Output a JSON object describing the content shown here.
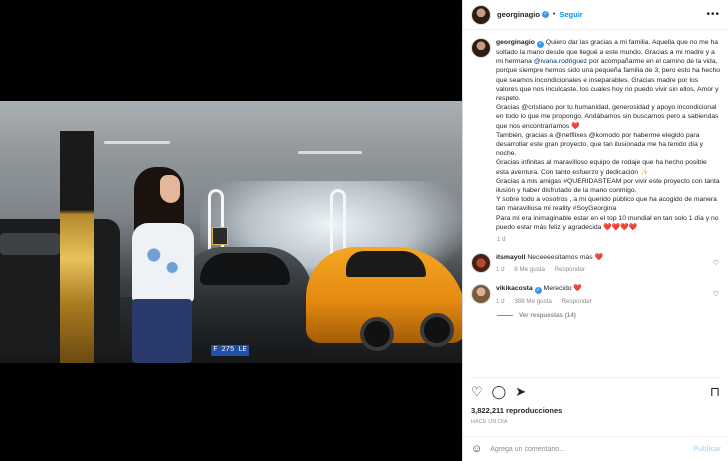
{
  "post": {
    "username": "georginagio",
    "follow_label": "Seguir",
    "more_label": "•••",
    "caption": [
      {
        "type": "user",
        "text": "georginagio"
      },
      {
        "type": "text",
        "text": " Quiero dar las gracias a mi familia. Aquella que no me ha soltado la mano desde que llegué a este mundo. Gracias a mi madre y a mi hermana "
      },
      {
        "type": "mention",
        "text": "@ivana.rodriguez"
      },
      {
        "type": "text",
        "text": " por acompañarme en el camino de la vida, porque siempre hemos sido una pequeña familia de 3, pero esto ha hecho que seamos incondicionales e inseparables. Gracias madre por los valores que nos inculcaste, los cuales hoy no puedo vivir sin ellos. Amor y respeto."
      }
    ],
    "caption_p2": "Gracias @cristiano por tu humanidad, generosidad y apoyo incondicional en todo lo que me propongo. Andábamos sin buscarnos pero a sabiendas que nos encontraríamos ❤️",
    "caption_p3": "También, gracias a @netflixes @komodo por haberme elegido para desarrollar este gran proyecto, que tan ilusionada me ha tenido día y noche.",
    "caption_p4": "Gracias infinitas al maravilloso equipo de rodaje que ha hecho posible esta aventura. Con tanto esfuerzo y dedicación ✨",
    "caption_p5": "Gracias a mis amigas #QUERIDASTEAM por vivir este proyecto con tanta ilusión y haber disfrutado de la mano conmigo.",
    "caption_p6": "Y sobre todo a vosotros , a mi querido público que ha acogido de manera tan maravillosa mi reality #SoyGeorgina",
    "caption_p7": "Para mí era inimaginable estar en el top 10 mundial en tan solo 1 día y no puedo estar más feliz y agradecida ❤️❤️❤️❤️",
    "caption_time": "1 d",
    "video_plate": "F 275 LE"
  },
  "comments": [
    {
      "username": "itsmayoll",
      "text": " Neceeeesitamos más ❤️",
      "time": "1 d",
      "likes": "8 Me gusta",
      "reply_label": "Responder"
    },
    {
      "username": "vikikacosta",
      "text": " Merecido ❤️",
      "time": "1 d",
      "likes": "388 Me gusta",
      "reply_label": "Responder",
      "view_replies": "Ver respuestas (14)"
    }
  ],
  "actions": {
    "views": "3,822,211 reproducciones",
    "posted": "HACE UN DÍA"
  },
  "composer": {
    "placeholder": "Agrega un comentario...",
    "publish_label": "Publicar"
  }
}
